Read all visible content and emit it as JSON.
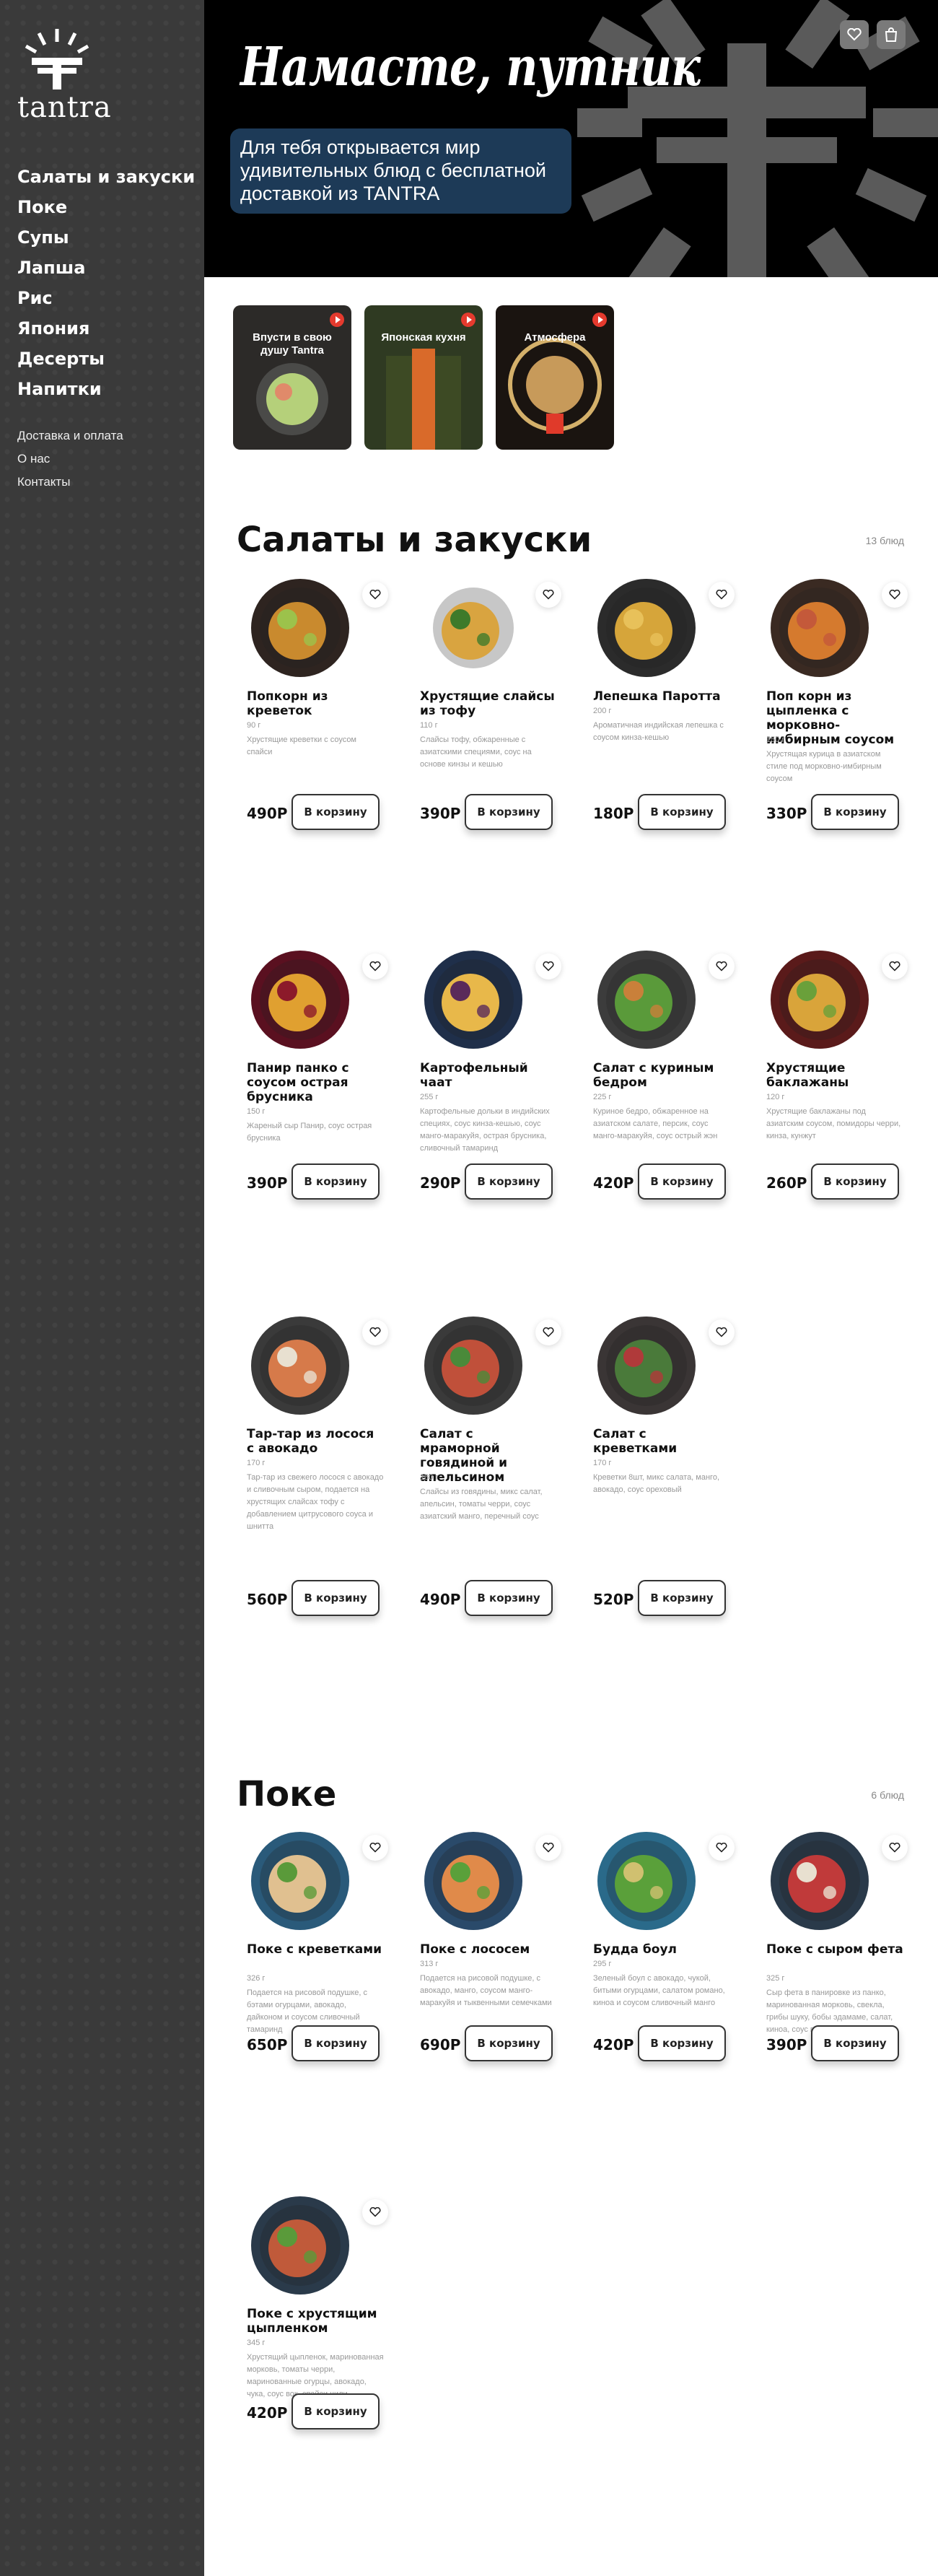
{
  "sidebar": {
    "logo_text": "tantra",
    "categories": [
      "Салаты и закуски",
      "Поке",
      "Супы",
      "Лапша",
      "Рис",
      "Япония",
      "Десерты",
      "Напитки"
    ],
    "links": [
      "Доставка и оплата",
      "О нас",
      "Контакты"
    ]
  },
  "hero": {
    "title": "Намасте, путник",
    "subtitle": "Для тебя открывается мир удивительных блюд с бесплатной доставкой из TANTRA",
    "favorites_icon": "heart-icon",
    "cart_icon": "bag-icon"
  },
  "stories": [
    {
      "label": "Впусти в свою душу Tantra"
    },
    {
      "label": "Японская кухня"
    },
    {
      "label": "Атмосфера"
    }
  ],
  "sections": [
    {
      "title": "Салаты и закуски",
      "count": "13 блюд",
      "items": [
        {
          "name": "Попкорн из креветок",
          "weight": "90 г",
          "desc": "Хрустящие креветки с соусом спайси",
          "price": "490Р",
          "cta": "В корзину",
          "plate": "#2e2420",
          "food": "#c98a2e",
          "accent": "#9cc24b"
        },
        {
          "name": "Хрустящие слайсы из тофу",
          "weight": "110 г",
          "desc": "Слайсы тофу, обжаренные с азиатскими специями, соус на основе кинзы и кешью",
          "price": "390Р",
          "cta": "В корзину",
          "plate": "#ffffff",
          "food": "#d9a440",
          "accent": "#3e7a2a"
        },
        {
          "name": "Лепешка Паротта",
          "weight": "200 г",
          "desc": "Ароматичная индийская лепешка с соусом кинза-кешью",
          "price": "180Р",
          "cta": "В корзину",
          "plate": "#2b2b2b",
          "food": "#d6a53a",
          "accent": "#e8c15a"
        },
        {
          "name": "Поп корн из цыпленка с морковно-имбирным соусом",
          "weight": "150 г",
          "desc": "Хрустящая курица в азиатском стиле под морковно-имбирным соусом",
          "price": "330Р",
          "cta": "В корзину",
          "plate": "#3a2a22",
          "food": "#d57a2e",
          "accent": "#c4593a"
        },
        {
          "name": "Панир панко с соусом острая брусника",
          "weight": "150 г",
          "desc": "Жареный сыр Панир, соус острая брусника",
          "price": "390Р",
          "cta": "В корзину",
          "plate": "#5a1020",
          "food": "#e0a030",
          "accent": "#8c1a2a"
        },
        {
          "name": "Картофельный чаат",
          "weight": "255 г",
          "desc": "Картофельные дольки в индийских специях, соус кинза-кешью, соус манго-маракуйя, острая брусника, сливочный тамаринд",
          "price": "290Р",
          "cta": "В корзину",
          "plate": "#1f2f4a",
          "food": "#e8b84a",
          "accent": "#5a2a5a"
        },
        {
          "name": "Салат с куриным бедром",
          "weight": "225 г",
          "desc": "Куриное бедро, обжаренное на азиатском салате, персик, соус манго-маракуйя, соус острый жэн",
          "price": "420Р",
          "cta": "В корзину",
          "plate": "#3c3c3c",
          "food": "#5a9a3a",
          "accent": "#c9803a"
        },
        {
          "name": "Хрустящие баклажаны",
          "weight": "120 г",
          "desc": "Хрустящие баклажаны под азиатским соусом, помидоры черри, кинза, кунжут",
          "price": "260Р",
          "cta": "В корзину",
          "plate": "#5a1a1a",
          "food": "#d9a43a",
          "accent": "#6aa03a"
        },
        {
          "name": "Тар-тар из лосося с авокадо",
          "weight": "170 г",
          "desc": "Тар-тар из свежего лосося с авокадо и сливочным сыром, подается на хрустящих слайсах тофу с добавлением цитрусового соуса и шнитта",
          "price": "560Р",
          "cta": "В корзину",
          "plate": "#3a3a3a",
          "food": "#d67a4a",
          "accent": "#e8e0d0"
        },
        {
          "name": "Салат с мраморной говядиной и апельсином",
          "weight": "180 г",
          "desc": "Слайсы из говядины, микс салат, апельсин, томаты черри, соус азиатский манго, перечный соус",
          "price": "490Р",
          "cta": "В корзину",
          "plate": "#3a3a3a",
          "food": "#c0503a",
          "accent": "#4a8a3a"
        },
        {
          "name": "Салат с креветками",
          "weight": "170 г",
          "desc": "Креветки 8шт, микс салата, манго, авокадо, соус ореховый",
          "price": "520Р",
          "cta": "В корзину",
          "plate": "#3a3535",
          "food": "#4a7a3a",
          "accent": "#b03a3a"
        }
      ]
    },
    {
      "title": "Поке",
      "count": "6 блюд",
      "items": [
        {
          "name": "Поке с креветками",
          "weight": "326 г",
          "desc": "Подается на рисовой подушке, с бэтами огурцами, авокадо, дайконом и соусом сливочный тамаринд",
          "price": "650Р",
          "cta": "В корзину",
          "plate": "#2a5a7a",
          "food": "#e0c090",
          "accent": "#5a9a3a"
        },
        {
          "name": "Поке с лососем",
          "weight": "313 г",
          "desc": "Подается на рисовой подушке, с авокадо, манго, соусом манго-маракуйя и тыквенными семечками",
          "price": "690Р",
          "cta": "В корзину",
          "plate": "#2a4a6a",
          "food": "#e08a4a",
          "accent": "#5aa03a"
        },
        {
          "name": "Будда боул",
          "weight": "295 г",
          "desc": "Зеленый боул с авокадо, чукой, битыми огурцами, салатом романо, киноа и соусом сливочный манго",
          "price": "420Р",
          "cta": "В корзину",
          "plate": "#2a6a8a",
          "food": "#5aa03a",
          "accent": "#d0c070"
        },
        {
          "name": "Поке с сыром фета",
          "weight": "325 г",
          "desc": "Сыр фета в панировке из панко, маринованная морковь, свекла, грибы шуку, бобы эдамаме, салат, киноа, соус вок, ореховый соус",
          "price": "390Р",
          "cta": "В корзину",
          "plate": "#2a3a4a",
          "food": "#c03a3a",
          "accent": "#e8e0d0"
        },
        {
          "name": "Поке с хрустящим цыпленком",
          "weight": "345 г",
          "desc": "Хрустящий цыпленок, маринованная морковь, томаты черри, маринованные огурцы, авокадо, чука, соус вок, спайси чили",
          "price": "420Р",
          "cta": "В корзину",
          "plate": "#2a3a4a",
          "food": "#c05a3a",
          "accent": "#5a9a3a"
        }
      ]
    }
  ]
}
